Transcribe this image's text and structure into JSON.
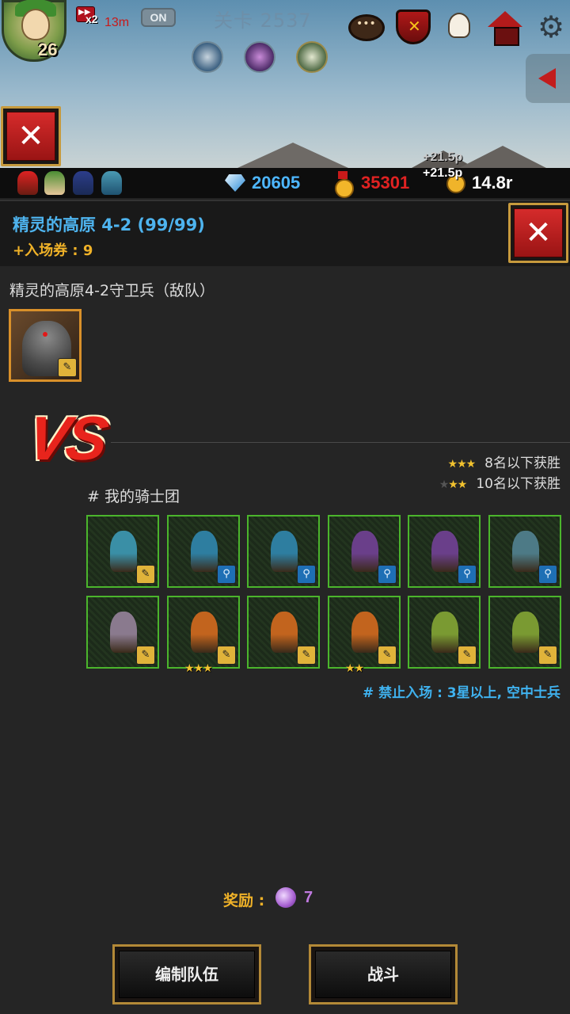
{
  "hud": {
    "player_level": "26",
    "speed": "x2",
    "timer": "13m",
    "auto_toggle": "ON",
    "stage_title": "关卡 2537",
    "floating_gold_1": "+21.5p",
    "floating_gold_2": "+21.5p"
  },
  "resources": {
    "gems": "20605",
    "medals": "35301",
    "gold": "14.8r"
  },
  "panel": {
    "stage_name": "精灵的高原 4-2  (99/99)",
    "ticket": "+入场券 : 9",
    "enemy_title": "精灵的高原4-2守卫兵（敌队）",
    "vs": "VS",
    "win_3star": "8名以下获胜",
    "win_2star": "10名以下获胜",
    "team_title": "# 我的骑士团",
    "ban_rule": "# 禁止入场 : 3星以上, 空中士兵",
    "reward_label": "奖励 :",
    "reward_value": "7",
    "edit_team_label": "编制队伍",
    "fight_label": "战斗"
  },
  "team_units": [
    {
      "row": 0,
      "col": 0,
      "name": "blue-goblin-club",
      "badge": "sword",
      "stars": 0,
      "color": "#3a8fa6"
    },
    {
      "row": 0,
      "col": 1,
      "name": "blue-goblin-mage",
      "badge": "magic",
      "stars": 0,
      "color": "#2e7ea0"
    },
    {
      "row": 0,
      "col": 2,
      "name": "blue-goblin-mage",
      "badge": "magic",
      "stars": 0,
      "color": "#2e7ea0"
    },
    {
      "row": 0,
      "col": 3,
      "name": "purple-hood-mage",
      "badge": "magic",
      "stars": 0,
      "color": "#6a3f8a"
    },
    {
      "row": 0,
      "col": 4,
      "name": "purple-hood-mage",
      "badge": "magic",
      "stars": 0,
      "color": "#6a3f8a"
    },
    {
      "row": 0,
      "col": 5,
      "name": "skull-shaman",
      "badge": "magic",
      "stars": 0,
      "color": "#4d7a86"
    },
    {
      "row": 1,
      "col": 0,
      "name": "pale-bandit",
      "badge": "sword",
      "stars": 0,
      "color": "#8a7a8e"
    },
    {
      "row": 1,
      "col": 1,
      "name": "orange-fox-warrior",
      "badge": "sword",
      "stars": 3,
      "color": "#c2641e"
    },
    {
      "row": 1,
      "col": 2,
      "name": "orange-fox-warrior",
      "badge": "sword",
      "stars": 0,
      "color": "#c2641e"
    },
    {
      "row": 1,
      "col": 3,
      "name": "orange-fox-warrior",
      "badge": "sword",
      "stars": 2,
      "color": "#c2641e"
    },
    {
      "row": 1,
      "col": 4,
      "name": "green-orc-club",
      "badge": "sword",
      "stars": 0,
      "color": "#7a9a32"
    },
    {
      "row": 1,
      "col": 5,
      "name": "green-orc-club",
      "badge": "sword",
      "stars": 0,
      "color": "#7a9a32"
    }
  ],
  "colors": {
    "accent_blue": "#4eb4ef",
    "accent_gold": "#f0b228",
    "accent_red": "#e02222",
    "unit_border": "#4bb52c"
  }
}
